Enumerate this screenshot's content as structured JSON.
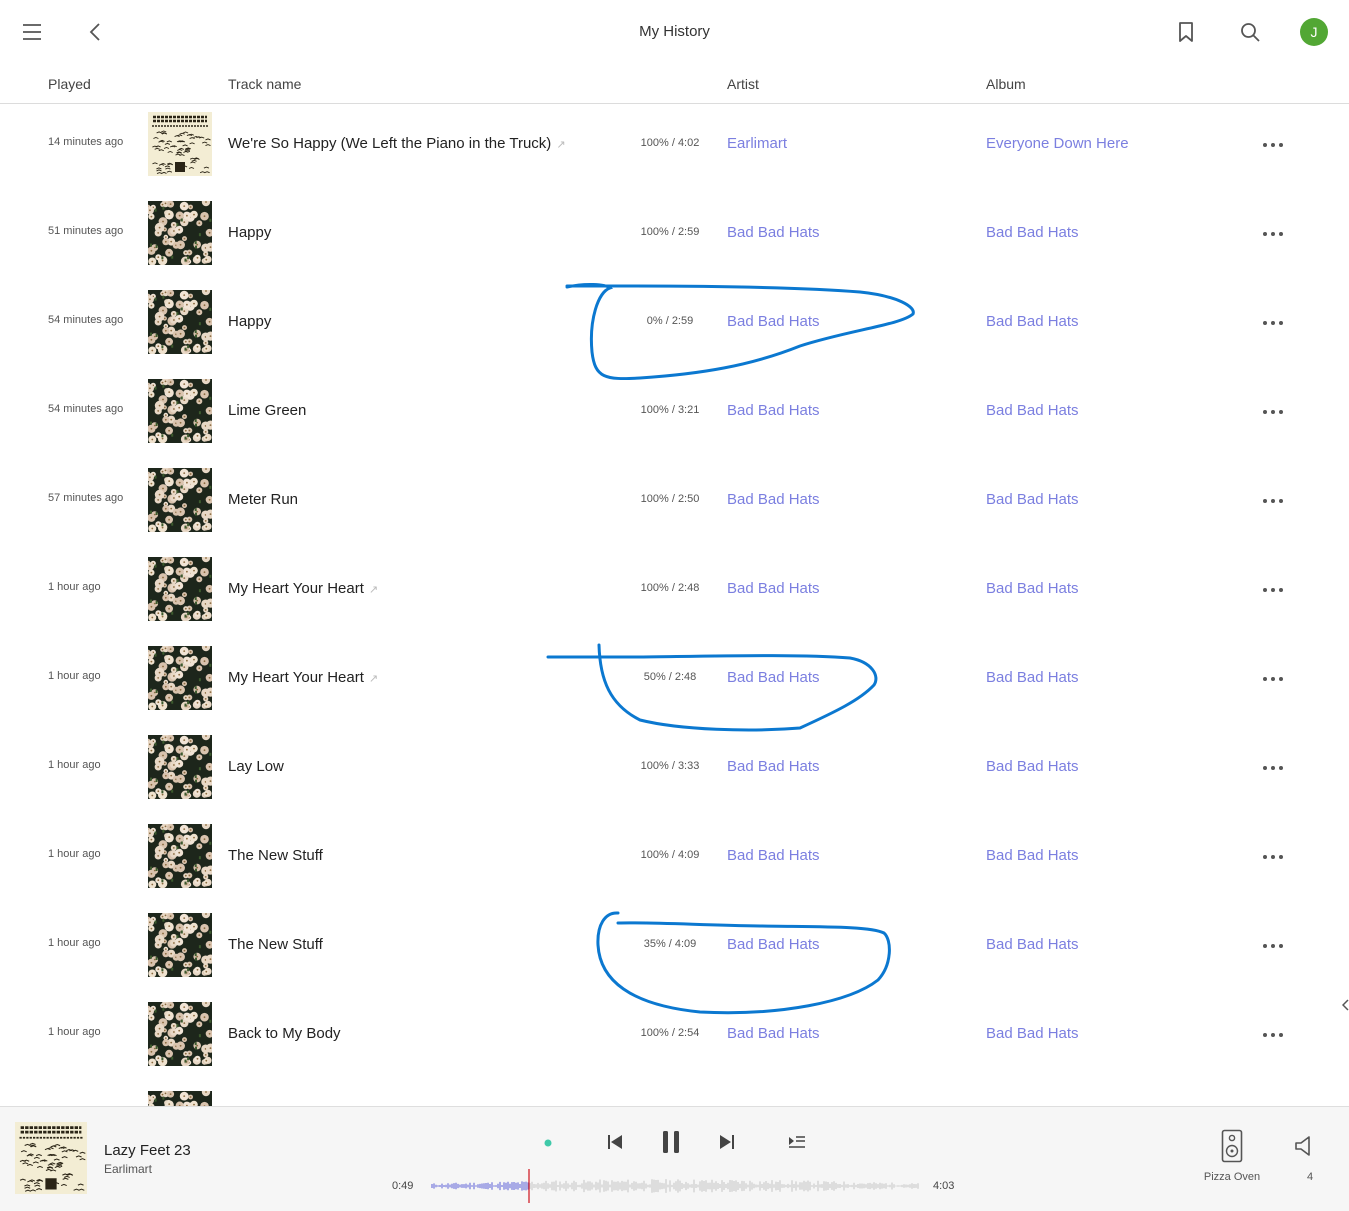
{
  "header": {
    "title": "My History",
    "avatar_initial": "J",
    "avatar_color": "#52a734"
  },
  "columns": {
    "played": "Played",
    "track": "Track name",
    "artist": "Artist",
    "album": "Album"
  },
  "rows": [
    {
      "played": "14 minutes ago",
      "track": "We're So Happy (We Left the Piano in the Truck)",
      "tag": true,
      "progress": "100% / 4:02",
      "artist": "Earlimart",
      "album": "Everyone Down Here",
      "art": "earlimart"
    },
    {
      "played": "51 minutes ago",
      "track": "Happy",
      "tag": false,
      "progress": "100% / 2:59",
      "artist": "Bad Bad Hats",
      "album": "Bad Bad Hats",
      "art": "flowers"
    },
    {
      "played": "54 minutes ago",
      "track": "Happy",
      "tag": false,
      "progress": "0% / 2:59",
      "artist": "Bad Bad Hats",
      "album": "Bad Bad Hats",
      "art": "flowers"
    },
    {
      "played": "54 minutes ago",
      "track": "Lime Green",
      "tag": false,
      "progress": "100% / 3:21",
      "artist": "Bad Bad Hats",
      "album": "Bad Bad Hats",
      "art": "flowers"
    },
    {
      "played": "57 minutes ago",
      "track": "Meter Run",
      "tag": false,
      "progress": "100% / 2:50",
      "artist": "Bad Bad Hats",
      "album": "Bad Bad Hats",
      "art": "flowers"
    },
    {
      "played": "1 hour ago",
      "track": "My Heart Your Heart",
      "tag": true,
      "progress": "100% / 2:48",
      "artist": "Bad Bad Hats",
      "album": "Bad Bad Hats",
      "art": "flowers"
    },
    {
      "played": "1 hour ago",
      "track": "My Heart Your Heart",
      "tag": true,
      "progress": "50% / 2:48",
      "artist": "Bad Bad Hats",
      "album": "Bad Bad Hats",
      "art": "flowers"
    },
    {
      "played": "1 hour ago",
      "track": "Lay Low",
      "tag": false,
      "progress": "100% / 3:33",
      "artist": "Bad Bad Hats",
      "album": "Bad Bad Hats",
      "art": "flowers"
    },
    {
      "played": "1 hour ago",
      "track": "The New Stuff",
      "tag": false,
      "progress": "100% / 4:09",
      "artist": "Bad Bad Hats",
      "album": "Bad Bad Hats",
      "art": "flowers"
    },
    {
      "played": "1 hour ago",
      "track": "The New Stuff",
      "tag": false,
      "progress": "35% / 4:09",
      "artist": "Bad Bad Hats",
      "album": "Bad Bad Hats",
      "art": "flowers"
    },
    {
      "played": "1 hour ago",
      "track": "Back to My Body",
      "tag": false,
      "progress": "100% / 2:54",
      "artist": "Bad Bad Hats",
      "album": "Bad Bad Hats",
      "art": "flowers"
    },
    {
      "played": "",
      "track": "",
      "tag": false,
      "progress": "",
      "artist": "",
      "album": "",
      "art": "flowers"
    }
  ],
  "player": {
    "title": "Lazy Feet 23",
    "artist": "Earlimart",
    "elapsed": "0:49",
    "duration": "4:03",
    "progress_fraction": 0.2,
    "zone": "Pizza Oven",
    "volume": "4",
    "indicator_color": "#3fc9a9"
  },
  "icons": {
    "menu": "menu-icon",
    "back": "back-icon",
    "bookmark": "bookmark-icon",
    "search": "search-icon",
    "more": "more-icon",
    "previous": "previous-icon",
    "pause": "pause-icon",
    "next": "next-icon",
    "queue": "queue-icon",
    "speaker": "speaker-icon",
    "volume": "volume-icon"
  },
  "colors": {
    "link": "#7b7fe0",
    "annotation": "#0b78d0",
    "waveform_played": "#5a5fd6",
    "waveform_unplayed": "#c4c4c4",
    "playhead": "#d4323a"
  }
}
